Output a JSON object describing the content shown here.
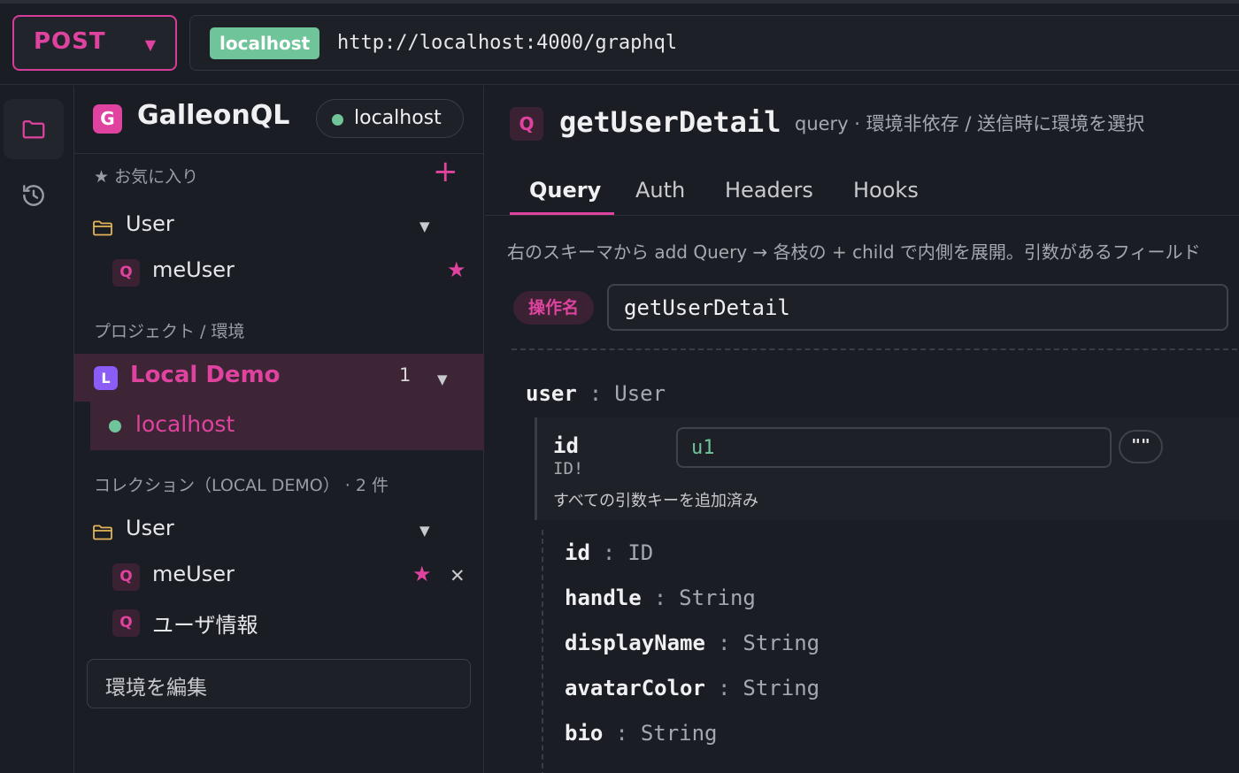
{
  "request": {
    "method": "POST",
    "env_chip": "localhost",
    "url": "http://localhost:4000/graphql"
  },
  "sidebar": {
    "app_name": "GalleonQL",
    "logo_letter": "G",
    "env_selector": "localhost",
    "favorites_label": "★ お気に入り",
    "favorites": {
      "folder": "User",
      "items": [
        {
          "badge": "Q",
          "name": "meUser"
        }
      ]
    },
    "projects_label": "プロジェクト / 環境",
    "project": {
      "badge": "L",
      "name": "Local Demo",
      "count": "1",
      "env": "localhost"
    },
    "collection_label": "コレクション（LOCAL DEMO） · 2 件",
    "collection": {
      "folder": "User",
      "items": [
        {
          "badge": "Q",
          "name": "meUser"
        },
        {
          "badge": "Q",
          "name": "ユーザ情報"
        }
      ]
    },
    "edit_env_label": "環境を編集"
  },
  "operation": {
    "badge": "Q",
    "name": "getUserDetail",
    "subtitle": "query · 環境非依存 / 送信時に環境を選択",
    "tabs": [
      "Query",
      "Auth",
      "Headers",
      "Hooks"
    ],
    "active_tab": "Query",
    "hint": "右のスキーマから add Query → 各枝の + child で内側を展開。引数があるフィールド",
    "opname_chip": "操作名",
    "opname_value": "getUserDetail"
  },
  "query_tree": {
    "root": {
      "name": "user",
      "sep": ":",
      "type": "User"
    },
    "arg": {
      "name": "id",
      "type": "ID!",
      "value": "u1",
      "quote_button": "\"\"",
      "note": "すべての引数キーを追加済み"
    },
    "fields": [
      {
        "name": "id",
        "sep": ":",
        "type": "ID"
      },
      {
        "name": "handle",
        "sep": ":",
        "type": "String"
      },
      {
        "name": "displayName",
        "sep": ":",
        "type": "String"
      },
      {
        "name": "avatarColor",
        "sep": ":",
        "type": "String"
      },
      {
        "name": "bio",
        "sep": ":",
        "type": "String"
      }
    ]
  },
  "colors": {
    "accent": "#e0439f",
    "success": "#6fc49a",
    "background": "#1b1d24"
  }
}
